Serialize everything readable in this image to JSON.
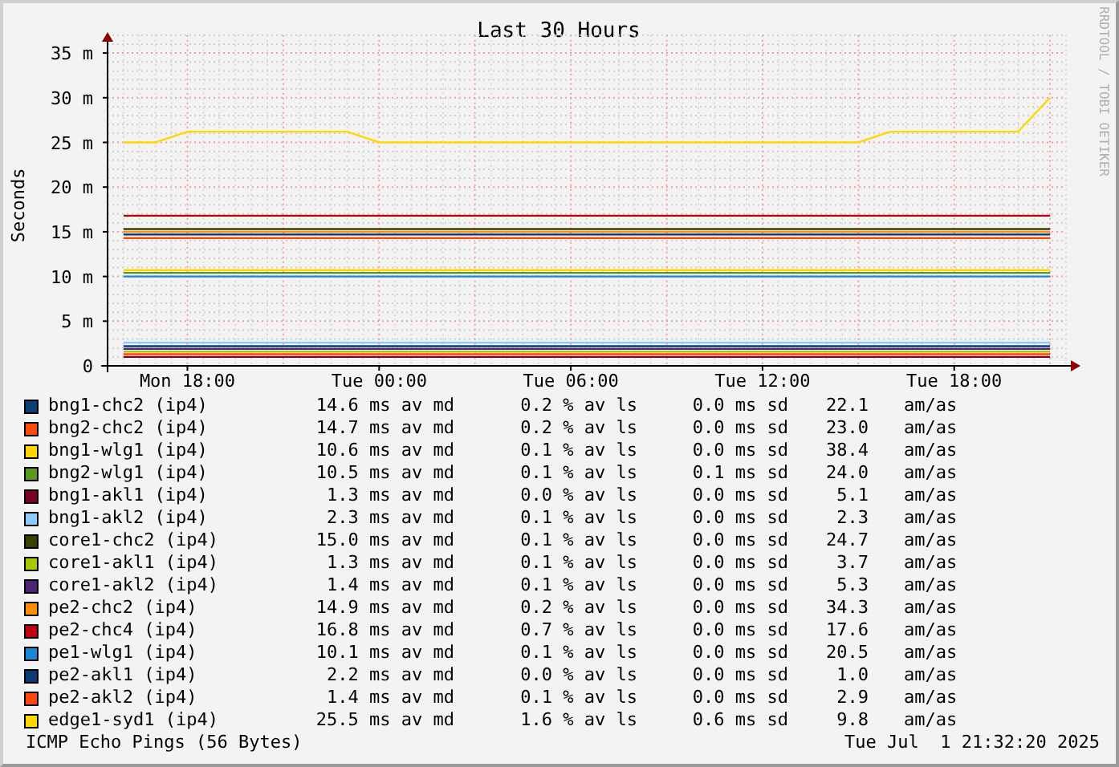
{
  "chart": {
    "side_label": "RRDTOOL / TOBI OETIKER",
    "chart_data": {
      "type": "line",
      "grid": true,
      "title": "Last 30 Hours",
      "ylabel": "Seconds",
      "ylim": [
        0,
        37
      ],
      "categories": [
        null,
        null,
        "Mon 18:00",
        null,
        null,
        null,
        null,
        null,
        "Tue 00:00",
        null,
        null,
        null,
        null,
        null,
        "Tue 06:00",
        null,
        null,
        null,
        null,
        null,
        "Tue 12:00",
        null,
        null,
        null,
        null,
        null,
        "Tue 18:00",
        null,
        null,
        null
      ],
      "yticks": [
        {
          "value": 0,
          "label": "0"
        },
        {
          "value": 5,
          "label": "5 m"
        },
        {
          "value": 10,
          "label": "10 m"
        },
        {
          "value": 15,
          "label": "15 m"
        },
        {
          "value": 20,
          "label": "20 m"
        },
        {
          "value": 25,
          "label": "25 m"
        },
        {
          "value": 30,
          "label": "30 m"
        },
        {
          "value": 35,
          "label": "35 m"
        }
      ],
      "series": [
        {
          "name": "bng1-chc2 (ip4)",
          "color": "#0b3f7a",
          "values": [
            14.7,
            14.7,
            14.7,
            14.7,
            14.7,
            14.7,
            14.7,
            14.7,
            14.7,
            14.7,
            14.7,
            14.7,
            14.7,
            14.7,
            14.7,
            14.7,
            14.7,
            14.7,
            14.7,
            14.7,
            14.7,
            14.7,
            14.7,
            14.7,
            14.7,
            14.7,
            14.7,
            14.7,
            14.7,
            14.7
          ]
        },
        {
          "name": "bng2-chc2 (ip4)",
          "color": "#ff4a0a",
          "values": [
            14.3,
            14.3,
            14.3,
            14.3,
            14.3,
            14.3,
            14.3,
            14.3,
            14.3,
            14.3,
            14.3,
            14.3,
            14.3,
            14.3,
            14.3,
            14.3,
            14.3,
            14.3,
            14.3,
            14.3,
            14.3,
            14.3,
            14.3,
            14.3,
            14.3,
            14.3,
            14.3,
            14.3,
            14.3,
            14.3
          ]
        },
        {
          "name": "bng1-wlg1 (ip4)",
          "color": "#ffd400",
          "values": [
            10.7,
            10.7,
            10.7,
            10.7,
            10.7,
            10.7,
            10.7,
            10.7,
            10.7,
            10.7,
            10.7,
            10.7,
            10.7,
            10.7,
            10.7,
            10.7,
            10.7,
            10.7,
            10.7,
            10.7,
            10.7,
            10.7,
            10.7,
            10.7,
            10.7,
            10.7,
            10.7,
            10.7,
            10.7,
            10.7
          ]
        },
        {
          "name": "bng2-wlg1 (ip4)",
          "color": "#5a9a1a",
          "values": [
            10.4,
            10.4,
            10.4,
            10.4,
            10.4,
            10.4,
            10.4,
            10.4,
            10.4,
            10.4,
            10.4,
            10.4,
            10.4,
            10.4,
            10.4,
            10.4,
            10.4,
            10.4,
            10.4,
            10.4,
            10.4,
            10.4,
            10.4,
            10.4,
            10.4,
            10.4,
            10.4,
            10.4,
            10.4,
            10.4
          ]
        },
        {
          "name": "bng1-akl1 (ip4)",
          "color": "#7a0026",
          "values": [
            1.0,
            1.0,
            1.0,
            1.0,
            1.0,
            1.0,
            1.0,
            1.0,
            1.0,
            1.0,
            1.0,
            1.0,
            1.0,
            1.0,
            1.0,
            1.0,
            1.0,
            1.0,
            1.0,
            1.0,
            1.0,
            1.0,
            1.0,
            1.0,
            1.0,
            1.0,
            1.0,
            1.0,
            1.0,
            1.0
          ]
        },
        {
          "name": "bng1-akl2 (ip4)",
          "color": "#8ccbff",
          "values": [
            2.6,
            2.6,
            2.6,
            2.6,
            2.6,
            2.6,
            2.6,
            2.6,
            2.6,
            2.6,
            2.6,
            2.6,
            2.6,
            2.6,
            2.6,
            2.6,
            2.6,
            2.6,
            2.6,
            2.6,
            2.6,
            2.6,
            2.6,
            2.6,
            2.6,
            2.6,
            2.6,
            2.6,
            2.6,
            2.6
          ]
        },
        {
          "name": "core1-chc2 (ip4)",
          "color": "#354200",
          "values": [
            15.3,
            15.3,
            15.3,
            15.3,
            15.3,
            15.3,
            15.3,
            15.3,
            15.3,
            15.3,
            15.3,
            15.3,
            15.3,
            15.3,
            15.3,
            15.3,
            15.3,
            15.3,
            15.3,
            15.3,
            15.3,
            15.3,
            15.3,
            15.3,
            15.3,
            15.3,
            15.3,
            15.3,
            15.3,
            15.3
          ]
        },
        {
          "name": "core1-akl1 (ip4)",
          "color": "#a6c800",
          "values": [
            1.6,
            1.6,
            1.6,
            1.6,
            1.6,
            1.6,
            1.6,
            1.6,
            1.6,
            1.6,
            1.6,
            1.6,
            1.6,
            1.6,
            1.6,
            1.6,
            1.6,
            1.6,
            1.6,
            1.6,
            1.6,
            1.6,
            1.6,
            1.6,
            1.6,
            1.6,
            1.6,
            1.6,
            1.6,
            1.6
          ]
        },
        {
          "name": "core1-akl2 (ip4)",
          "color": "#4b2475",
          "values": [
            1.9,
            1.9,
            1.9,
            1.9,
            1.9,
            1.9,
            1.9,
            1.9,
            1.9,
            1.9,
            1.9,
            1.9,
            1.9,
            1.9,
            1.9,
            1.9,
            1.9,
            1.9,
            1.9,
            1.9,
            1.9,
            1.9,
            1.9,
            1.9,
            1.9,
            1.9,
            1.9,
            1.9,
            1.9,
            1.9
          ]
        },
        {
          "name": "pe2-chc2 (ip4)",
          "color": "#ff8c0a",
          "values": [
            15.0,
            15.0,
            15.0,
            15.0,
            15.0,
            15.0,
            15.0,
            15.0,
            15.0,
            15.0,
            15.0,
            15.0,
            15.0,
            15.0,
            15.0,
            15.0,
            15.0,
            15.0,
            15.0,
            15.0,
            15.0,
            15.0,
            15.0,
            15.0,
            15.0,
            15.0,
            15.0,
            15.0,
            15.0,
            15.0
          ]
        },
        {
          "name": "pe2-chc4 (ip4)",
          "color": "#c00010",
          "values": [
            16.8,
            16.8,
            16.8,
            16.8,
            16.8,
            16.8,
            16.8,
            16.8,
            16.8,
            16.8,
            16.8,
            16.8,
            16.8,
            16.8,
            16.8,
            16.8,
            16.8,
            16.8,
            16.8,
            16.8,
            16.8,
            16.8,
            16.8,
            16.8,
            16.8,
            16.8,
            16.8,
            16.8,
            16.8,
            16.8
          ]
        },
        {
          "name": "pe1-wlg1 (ip4)",
          "color": "#1a86d8",
          "values": [
            10.0,
            10.0,
            10.0,
            10.0,
            10.0,
            10.0,
            10.0,
            10.0,
            10.0,
            10.0,
            10.0,
            10.0,
            10.0,
            10.0,
            10.0,
            10.0,
            10.0,
            10.0,
            10.0,
            10.0,
            10.0,
            10.0,
            10.0,
            10.0,
            10.0,
            10.0,
            10.0,
            10.0,
            10.0,
            10.0
          ]
        },
        {
          "name": "pe2-akl1 (ip4)",
          "color": "#0a3a78",
          "values": [
            2.2,
            2.2,
            2.2,
            2.2,
            2.2,
            2.2,
            2.2,
            2.2,
            2.2,
            2.2,
            2.2,
            2.2,
            2.2,
            2.2,
            2.2,
            2.2,
            2.2,
            2.2,
            2.2,
            2.2,
            2.2,
            2.2,
            2.2,
            2.2,
            2.2,
            2.2,
            2.2,
            2.2,
            2.2,
            2.2
          ]
        },
        {
          "name": "pe2-akl2 (ip4)",
          "color": "#ff4510",
          "values": [
            1.3,
            1.3,
            1.3,
            1.3,
            1.3,
            1.3,
            1.3,
            1.3,
            1.3,
            1.3,
            1.3,
            1.3,
            1.3,
            1.3,
            1.3,
            1.3,
            1.3,
            1.3,
            1.3,
            1.3,
            1.3,
            1.3,
            1.3,
            1.3,
            1.3,
            1.3,
            1.3,
            1.3,
            1.3,
            1.3
          ]
        },
        {
          "name": "edge1-syd1 (ip4)",
          "color": "#ffd800",
          "values": [
            25.0,
            25.0,
            26.2,
            26.2,
            26.2,
            26.2,
            26.2,
            26.2,
            25.0,
            25.0,
            25.0,
            25.0,
            25.0,
            25.0,
            25.0,
            25.0,
            25.0,
            25.0,
            25.0,
            25.0,
            25.0,
            25.0,
            25.0,
            25.0,
            26.2,
            26.2,
            26.2,
            26.2,
            26.2,
            30.0
          ]
        }
      ]
    }
  },
  "legend": [
    {
      "median": "14.6 ms av md",
      "loss": "0.2 % av ls",
      "sd": "0.0 ms sd",
      "ratio": "22.1",
      "unit": "am/as"
    },
    {
      "median": "14.7 ms av md",
      "loss": "0.2 % av ls",
      "sd": "0.0 ms sd",
      "ratio": "23.0",
      "unit": "am/as"
    },
    {
      "median": "10.6 ms av md",
      "loss": "0.1 % av ls",
      "sd": "0.0 ms sd",
      "ratio": "38.4",
      "unit": "am/as"
    },
    {
      "median": "10.5 ms av md",
      "loss": "0.1 % av ls",
      "sd": "0.1 ms sd",
      "ratio": "24.0",
      "unit": "am/as"
    },
    {
      "median": "1.3 ms av md",
      "loss": "0.0 % av ls",
      "sd": "0.0 ms sd",
      "ratio": "5.1",
      "unit": "am/as"
    },
    {
      "median": "2.3 ms av md",
      "loss": "0.1 % av ls",
      "sd": "0.0 ms sd",
      "ratio": "2.3",
      "unit": "am/as"
    },
    {
      "median": "15.0 ms av md",
      "loss": "0.1 % av ls",
      "sd": "0.0 ms sd",
      "ratio": "24.7",
      "unit": "am/as"
    },
    {
      "median": "1.3 ms av md",
      "loss": "0.1 % av ls",
      "sd": "0.0 ms sd",
      "ratio": "3.7",
      "unit": "am/as"
    },
    {
      "median": "1.4 ms av md",
      "loss": "0.1 % av ls",
      "sd": "0.0 ms sd",
      "ratio": "5.3",
      "unit": "am/as"
    },
    {
      "median": "14.9 ms av md",
      "loss": "0.2 % av ls",
      "sd": "0.0 ms sd",
      "ratio": "34.3",
      "unit": "am/as"
    },
    {
      "median": "16.8 ms av md",
      "loss": "0.7 % av ls",
      "sd": "0.0 ms sd",
      "ratio": "17.6",
      "unit": "am/as"
    },
    {
      "median": "10.1 ms av md",
      "loss": "0.1 % av ls",
      "sd": "0.0 ms sd",
      "ratio": "20.5",
      "unit": "am/as"
    },
    {
      "median": "2.2 ms av md",
      "loss": "0.0 % av ls",
      "sd": "0.0 ms sd",
      "ratio": "1.0",
      "unit": "am/as"
    },
    {
      "median": "1.4 ms av md",
      "loss": "0.1 % av ls",
      "sd": "0.0 ms sd",
      "ratio": "2.9",
      "unit": "am/as"
    },
    {
      "median": "25.5 ms av md",
      "loss": "1.6 % av ls",
      "sd": "0.6 ms sd",
      "ratio": "9.8",
      "unit": "am/as"
    }
  ],
  "footer": {
    "probe": "ICMP Echo Pings (56 Bytes)",
    "timestamp": "Tue Jul  1 21:32:20 2025"
  }
}
